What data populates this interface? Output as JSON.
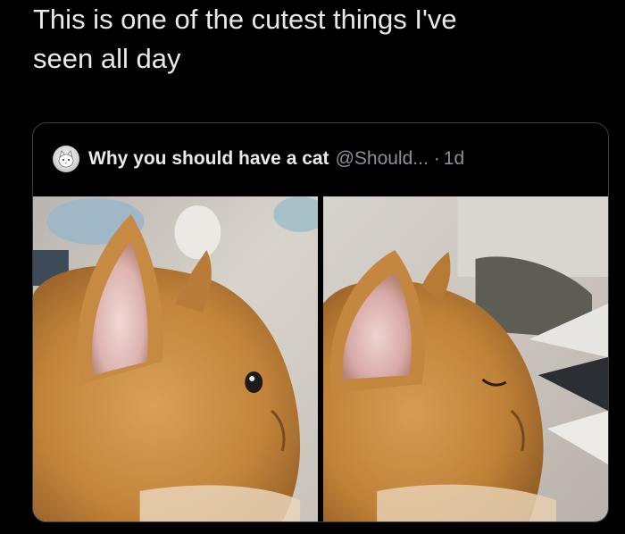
{
  "tweet": {
    "text_line_1": "This is one of the cutest things I've",
    "text_line_2": "seen all day"
  },
  "quote": {
    "author_name": "Why you should have a cat",
    "author_handle": "@Should...",
    "separator": "·",
    "time": "1d",
    "avatar_icon": "cat-avatar-icon"
  },
  "media": {
    "photos": [
      {
        "icon": "cat-profile-eyes-open-photo"
      },
      {
        "icon": "cat-profile-eyes-closed-photo"
      }
    ]
  },
  "colors": {
    "background": "#000000",
    "text_primary": "#e7e9ea",
    "text_secondary": "#8b9196",
    "card_border": "#3a3d40",
    "fur": "#c8883c"
  }
}
